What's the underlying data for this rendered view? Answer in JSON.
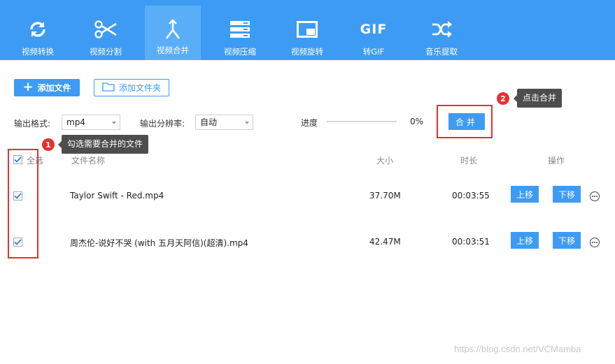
{
  "toolbar": {
    "accent": "#3d9bf4",
    "items": [
      {
        "label": "视频转换",
        "icon": "convert-icon"
      },
      {
        "label": "视频分割",
        "icon": "scissors-icon"
      },
      {
        "label": "视频合并",
        "icon": "merge-icon"
      },
      {
        "label": "视频压缩",
        "icon": "compress-icon"
      },
      {
        "label": "视频旋转",
        "icon": "rotate-icon"
      },
      {
        "label": "转GIF",
        "icon": "gif-icon"
      },
      {
        "label": "音乐提取",
        "icon": "shuffle-icon"
      }
    ],
    "gif_text": "GIF"
  },
  "actions": {
    "add_file": "添加文件",
    "add_folder": "添加文件夹"
  },
  "settings": {
    "format_label": "输出格式:",
    "format_value": "mp4",
    "resolution_label": "输出分辨率:",
    "resolution_value": "自动",
    "progress_label": "进度",
    "progress_value": "0%",
    "merge_button": "合并"
  },
  "annotations": [
    {
      "number": "1",
      "text": "勾选需要合并的文件"
    },
    {
      "number": "2",
      "text": "点击合并"
    }
  ],
  "table": {
    "headers": {
      "select_all": "全选",
      "name": "文件名称",
      "size": "大小",
      "duration": "时长",
      "actions": "操作"
    },
    "rows": [
      {
        "name": "Taylor Swift - Red.mp4",
        "size": "37.70M",
        "duration": "00:03:55",
        "up": "上移",
        "down": "下移"
      },
      {
        "name": "周杰伦-说好不哭 (with 五月天阿信)(超清).mp4",
        "size": "42.47M",
        "duration": "00:03:51",
        "up": "上移",
        "down": "下移"
      }
    ]
  },
  "watermark": "https://blog.csdn.net/VCMamba"
}
